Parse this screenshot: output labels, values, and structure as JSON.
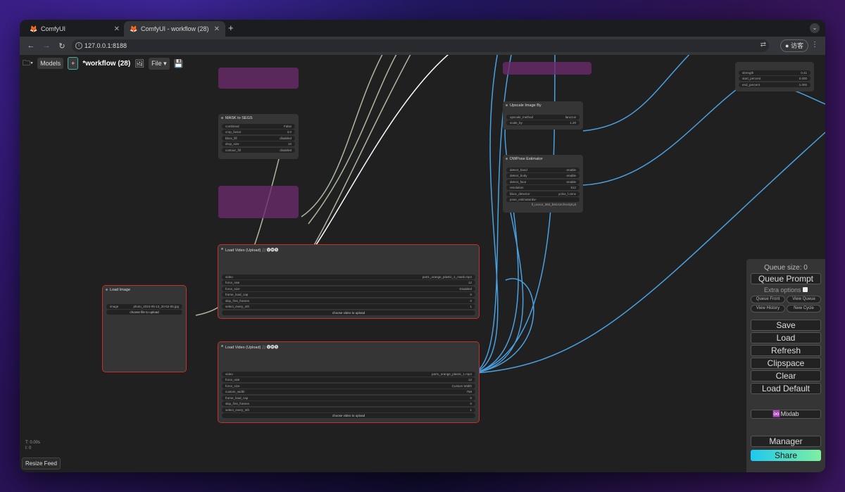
{
  "browser": {
    "tabs": [
      {
        "title": "ComfyUI",
        "active": false
      },
      {
        "title": "ComfyUI - workflow (28)",
        "active": true
      }
    ],
    "url": "127.0.0.1:8188",
    "profile_label": "访客"
  },
  "toolbar": {
    "models_label": "Models",
    "add_label": "+",
    "workflow_title": "*workflow (28)",
    "file_label": "File ▾"
  },
  "nodes": {
    "mask_to_segs": {
      "title": "MASK to SEGS",
      "widgets": [
        {
          "name": "combined",
          "value": "False"
        },
        {
          "name": "crop_factor",
          "value": "3.0"
        },
        {
          "name": "bbox_fill",
          "value": "disabled"
        },
        {
          "name": "drop_size",
          "value": "10"
        },
        {
          "name": "contour_fill",
          "value": "disabled"
        }
      ]
    },
    "upscale_image_by": {
      "title": "Upscale Image By",
      "widgets": [
        {
          "name": "upscale_method",
          "value": "lanczos"
        },
        {
          "name": "scale_by",
          "value": "1.20"
        }
      ]
    },
    "dwpose": {
      "title": "DWPose Estimator",
      "widgets": [
        {
          "name": "detect_hand",
          "value": "enable"
        },
        {
          "name": "detect_body",
          "value": "enable"
        },
        {
          "name": "detect_face",
          "value": "enable"
        },
        {
          "name": "resolution",
          "value": "512"
        },
        {
          "name": "bbox_detector",
          "value": "yolox_l.onnx"
        },
        {
          "name": "pose_estimator",
          "value": "dw-ll_ucoco_384_bs5.torchscript.pt"
        }
      ]
    },
    "controlnet": {
      "widgets": [
        {
          "name": "strength",
          "value": "0.41"
        },
        {
          "name": "start_percent",
          "value": "0.000"
        },
        {
          "name": "end_percent",
          "value": "1.000"
        }
      ]
    },
    "load_image": {
      "title": "Load Image",
      "image_name": "image",
      "image_value": "photo_2024-05-13_20-52-55.jpg",
      "upload_label": "choose file to upload"
    },
    "load_video_1": {
      "title": "Load Video (Upload) 🎥🅥🅗🅢",
      "widgets": [
        {
          "name": "video",
          "value": "part1_orange_plastic_1_mask.mp4"
        },
        {
          "name": "force_rate",
          "value": "12"
        },
        {
          "name": "force_size",
          "value": "Disabled"
        },
        {
          "name": "frame_load_cap",
          "value": "0"
        },
        {
          "name": "skip_first_frames",
          "value": "0"
        },
        {
          "name": "select_every_nth",
          "value": "1"
        }
      ],
      "upload_label": "choose video to upload"
    },
    "load_video_2": {
      "title": "Load Video (Upload) 🎥🅥🅗🅢",
      "widgets": [
        {
          "name": "video",
          "value": "part1_orange_plastic_1.mp4"
        },
        {
          "name": "force_rate",
          "value": "12"
        },
        {
          "name": "force_size",
          "value": "Custom Width"
        },
        {
          "name": "custom_width",
          "value": "768"
        },
        {
          "name": "frame_load_cap",
          "value": "0"
        },
        {
          "name": "skip_first_frames",
          "value": "0"
        },
        {
          "name": "select_every_nth",
          "value": "1"
        }
      ],
      "upload_label": "choose video to upload"
    }
  },
  "panel": {
    "queue_size": "Queue size: 0",
    "queue_prompt": "Queue Prompt",
    "extra_options": "Extra options",
    "queue_front": "Queue Front",
    "view_queue": "View Queue",
    "view_history": "View History",
    "new_cycle": "New Cycle",
    "save": "Save",
    "load": "Load",
    "refresh": "Refresh",
    "clipspace": "Clipspace",
    "clear": "Clear",
    "load_default": "Load Default",
    "mixlab": "♾️Mixlab",
    "manager": "Manager",
    "share": "Share"
  },
  "stats": {
    "t": "T: 0.00s",
    "i": "I: 0"
  },
  "resize_feed": "Resize Feed"
}
